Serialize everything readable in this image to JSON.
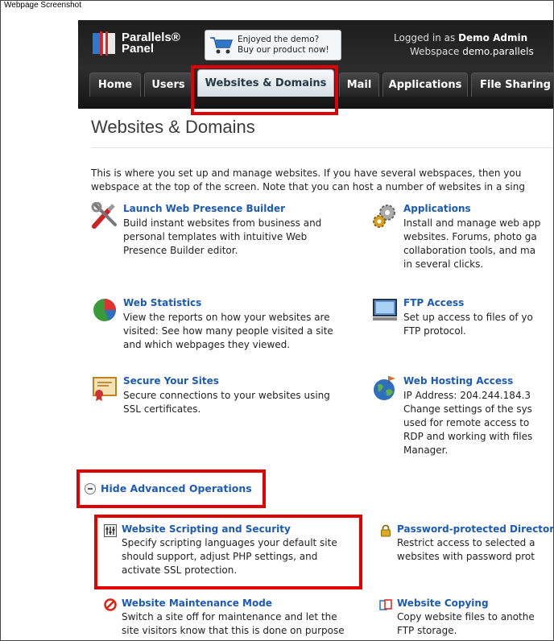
{
  "caption": "Webpage Screenshot",
  "header": {
    "logo_line1": "Parallels®",
    "logo_line2": "Panel",
    "promo_line1": "Enjoyed the demo?",
    "promo_line2": "Buy our product now!",
    "logged_in_label": "Logged in as",
    "logged_in_user": "Demo Admin",
    "webspace_label": "Webspace",
    "webspace_value": "demo.parallels"
  },
  "tabs": [
    "Home",
    "Users",
    "Websites & Domains",
    "Mail",
    "Applications",
    "File Sharing"
  ],
  "active_tab": "Websites & Domains",
  "page": {
    "title": "Websites & Domains",
    "intro_line1": "This is where you set up and manage websites. If you have several webspaces, then you",
    "intro_line2": "webspace at the top of the screen. Note that you can host a number of websites in a sing"
  },
  "features": [
    {
      "title": "Launch Web Presence Builder",
      "icon": "tools-icon",
      "desc": [
        "Build instant websites from business and",
        "personal templates with intuitive Web",
        "Presence Builder editor."
      ]
    },
    {
      "title": "Applications",
      "icon": "gears-icon",
      "desc": [
        "Install and manage web app",
        "websites. Forums, photo ga",
        "collaboration tools, and ma",
        "in several clicks."
      ]
    },
    {
      "title": "Web Statistics",
      "icon": "pie-chart-icon",
      "desc": [
        "View the reports on how your websites are",
        "visited: See how many people visited a site",
        "and which webpages they viewed."
      ]
    },
    {
      "title": "FTP Access",
      "icon": "monitor-icon",
      "desc": [
        "Set up access to files of yo",
        "FTP protocol."
      ]
    },
    {
      "title": "Secure Your Sites",
      "icon": "certificate-icon",
      "desc": [
        "Secure connections to your websites using",
        "SSL certificates."
      ]
    },
    {
      "title": "Web Hosting Access",
      "icon": "globe-icon",
      "desc": [
        "IP Address: 204.244.184.3",
        "Change settings of the sys",
        "used for remote access to",
        "RDP and working with files",
        "Manager."
      ]
    }
  ],
  "advanced_toggle": "Hide Advanced Operations",
  "advanced": [
    {
      "title": "Website Scripting and Security",
      "icon": "sliders-icon",
      "desc": [
        "Specify scripting languages your default site",
        "should support, adjust PHP settings, and",
        "activate SSL protection."
      ]
    },
    {
      "title": "Password-protected Director",
      "icon": "lock-icon",
      "desc": [
        "Restrict access to selected a",
        "websites with password prot"
      ]
    },
    {
      "title": "Website Maintenance Mode",
      "icon": "no-entry-icon",
      "desc": [
        "Switch a site off for maintenance and let the",
        "site visitors know that this is done on purpose"
      ]
    },
    {
      "title": "Website Copying",
      "icon": "copy-icon",
      "desc": [
        "Copy website files to anothe",
        "FTP storage."
      ]
    }
  ],
  "colors": {
    "highlight": "#e00000",
    "link": "#1c5ab3",
    "header_bg": "#222222"
  }
}
